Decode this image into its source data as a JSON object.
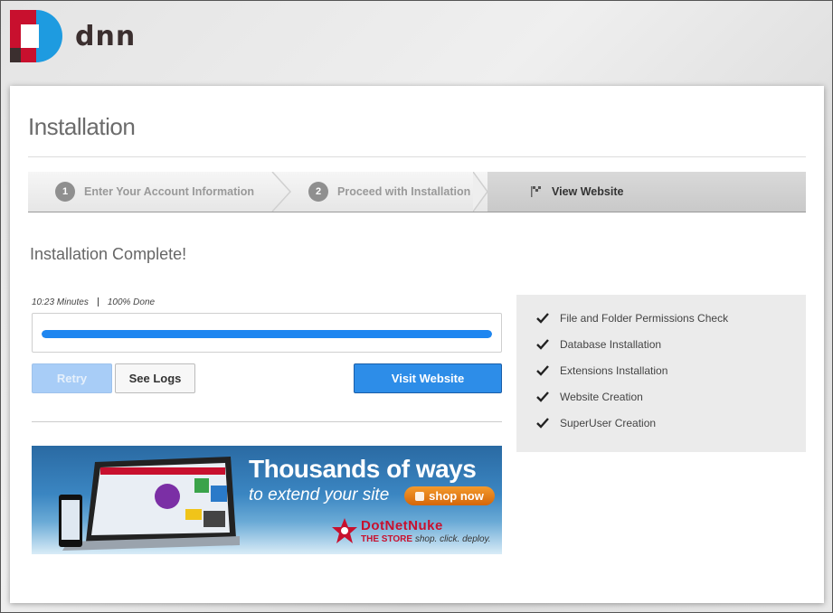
{
  "brand": {
    "logo_text": "dnn"
  },
  "page": {
    "title": "Installation"
  },
  "steps": [
    {
      "number": "1",
      "label": "Enter Your Account Information",
      "state": "done"
    },
    {
      "number": "2",
      "label": "Proceed with Installation",
      "state": "done"
    },
    {
      "number": "",
      "label": "View Website",
      "state": "active",
      "icon": "flag-icon"
    }
  ],
  "status": {
    "heading": "Installation Complete!"
  },
  "progress": {
    "elapsed": "10:23 Minutes",
    "percent_text": "100% Done",
    "value": 1.0
  },
  "buttons": {
    "retry": "Retry",
    "see_logs": "See Logs",
    "visit_website": "Visit Website"
  },
  "banner": {
    "headline": "Thousands of ways",
    "subline": "to extend your site",
    "cta": "shop now",
    "store_name": "DotNetNuke",
    "store_sub": "THE STORE",
    "store_tagline": "shop. click. deploy."
  },
  "checklist": [
    {
      "label": "File and Folder Permissions Check",
      "icon": "checkmark-icon"
    },
    {
      "label": "Database Installation",
      "icon": "checkmark-icon"
    },
    {
      "label": "Extensions Installation",
      "icon": "checkmark-icon"
    },
    {
      "label": "Website Creation",
      "icon": "checkmark-icon"
    },
    {
      "label": "SuperUser Creation",
      "icon": "checkmark-icon"
    }
  ],
  "colors": {
    "accent": "#2d8de8",
    "progress": "#1e86f0",
    "brand_red": "#c8102e",
    "brand_blue": "#1e9be0"
  }
}
